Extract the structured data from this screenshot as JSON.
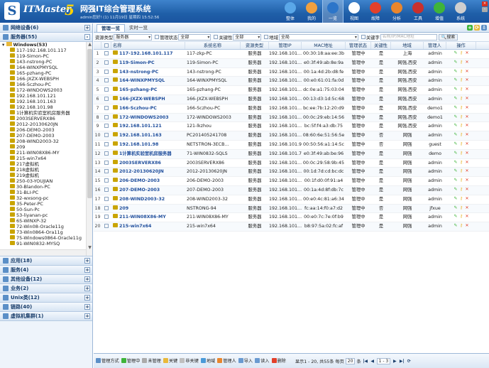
{
  "header": {
    "logo_letter": "S",
    "brand": "ITMaster",
    "brand_num": "5",
    "title": "网强IT综合管理系统",
    "user_info": "admin您好! (1) 11月19日 星期四 15:52:56"
  },
  "nav": [
    {
      "label": "整体",
      "icon": "monitor-icon",
      "color": "#5aa7e8"
    },
    {
      "label": "我的",
      "icon": "user-icon",
      "color": "#f0a040"
    },
    {
      "label": "一览",
      "icon": "list-icon",
      "color": "#2c75c9"
    },
    {
      "label": "视图",
      "icon": "view-icon",
      "color": "#ffffff"
    },
    {
      "label": "故障",
      "icon": "alert-icon",
      "color": "#e2402a"
    },
    {
      "label": "分析",
      "icon": "chart-icon",
      "color": "#e9862d"
    },
    {
      "label": "工具",
      "icon": "tool-icon",
      "color": "#c9302c"
    },
    {
      "label": "增值",
      "icon": "plus-icon",
      "color": "#3fb43a"
    },
    {
      "label": "系统",
      "icon": "gear-icon",
      "color": "#cfcfcf"
    }
  ],
  "sidebar": {
    "sections_top": [
      {
        "label": "网络设备(6)",
        "toggle": "+"
      },
      {
        "label": "服务器(55)",
        "toggle": "-"
      }
    ],
    "group": "Windows(53)",
    "tree_items": [
      "117-192.168.101.117",
      "119-Simon-PC",
      "143-nstrong-PC",
      "164-WINXPMYSQL",
      "165-pzhang-PC",
      "166-JXZX-WEBSPH",
      "166-Sczhou-PC",
      "172-WINDOWS2003",
      "192.168.101.121",
      "192.168.101.163",
      "192.168.101.98",
      "1计算机实验室机房服务器",
      "2003SERVERX86",
      "2012-20130620JN",
      "206-DEMO-2003",
      "207-DEMO-2003",
      "208-WIND2003-32",
      "209",
      "211-WIN08X86-MY",
      "215-win7x64",
      "217虚拟机",
      "218虚拟机",
      "219虚拟机",
      "250-03-YOUJIAN",
      "30-Blandon-PC",
      "31-BLI-PC",
      "32-wxsong-pc",
      "35-Peter-PC",
      "50-Sun-Pc",
      "53-liyanan-pc",
      "65-WINXP-32",
      "72-Win08-Oracle11g",
      "73-Win0864-Ora11g",
      "75-Windows0864-Oracle11g",
      "91-WIN0832-MYSQ"
    ],
    "sections_bottom": [
      {
        "label": "应用(18)",
        "toggle": "+"
      },
      {
        "label": "服务(4)",
        "toggle": "+"
      },
      {
        "label": "其他设备(12)",
        "toggle": "+"
      },
      {
        "label": "业务(2)",
        "toggle": "+"
      },
      {
        "label": "Unix类(12)",
        "toggle": "+"
      },
      {
        "label": "链路(40)",
        "toggle": "+"
      },
      {
        "label": "虚拟机集群(1)",
        "toggle": "+"
      }
    ]
  },
  "tabs": [
    "管理一览",
    "实时一览"
  ],
  "filter": {
    "type_label": "资源类型",
    "type_value": "服务器",
    "status_label": "管理状态",
    "status_value": "全部",
    "key_label": "关键性",
    "key_value": "全部",
    "region_label": "地域",
    "region_value": "全局",
    "keyword_label": "关键字",
    "keyword_placeholder": "名称/IP/MAC地址",
    "search_label": "搜索"
  },
  "table": {
    "columns": [
      "",
      "",
      "名称",
      "系统名称",
      "资源类型",
      "管理IP",
      "MAC地址",
      "管理状态",
      "关键性",
      "地域",
      "管理人",
      "操作"
    ],
    "rows": [
      [
        "1",
        "117-192.168.101.117",
        "117-zkp-PC",
        "服务器",
        "192.168.101....",
        "00:30:18:aa:ee:3b",
        "管理中",
        "是",
        "上海",
        "admin"
      ],
      [
        "2",
        "119-Simon-PC",
        "119-Simon-PC",
        "服务器",
        "192.168.101....",
        "e0:3f:49:ab:8e:9a",
        "管理中",
        "是",
        "网强,西安",
        "admin"
      ],
      [
        "3",
        "143-nstrong-PC",
        "143-nstrong-PC",
        "服务器",
        "192.168.101....",
        "00:1a:4d:2b:d8:fe",
        "管理中",
        "是",
        "网强,西安",
        "admin"
      ],
      [
        "4",
        "164-WINXPMYSQL",
        "164-WINXPMYSQL",
        "服务器",
        "192.168.101....",
        "00:e0:61:01:fa:0d",
        "管理中",
        "是",
        "网强,西安",
        "admin"
      ],
      [
        "5",
        "165-pzhang-PC",
        "165-pzhang-PC",
        "服务器",
        "192.168.101....",
        "dc:0e:a1:75:03:04",
        "管理中",
        "是",
        "网强,西安",
        "admin"
      ],
      [
        "6",
        "166-JXZX-WEBSPH",
        "166-JXZX-WEBSPH",
        "服务器",
        "192.168.101....",
        "00:13:d3:1d:5c:68",
        "管理中",
        "是",
        "网强,西安",
        "admin"
      ],
      [
        "7",
        "166-Sczhou-PC",
        "166-Sczhou-PC",
        "服务器",
        "192.168.101....",
        "bc:ee:7b:12:20:d9",
        "管理中",
        "是",
        "网强,西安",
        "demo1"
      ],
      [
        "8",
        "172-WINDOWS2003",
        "172-WINDOWS2003",
        "服务器",
        "192.168.101....",
        "00:0c:29:eb:14:56",
        "管理中",
        "是",
        "网强,西安",
        "demo1"
      ],
      [
        "9",
        "192.168.101.121",
        "121-lkzhou",
        "服务器",
        "192.168.101....",
        "bc:5f:f4:a3:db:75",
        "管理中",
        "是",
        "网强,西安",
        "admin"
      ],
      [
        "10",
        "192.168.101.163",
        "PC201405241708",
        "服务器",
        "192.168.101....",
        "08:60:6e:51:56:5e",
        "管理中",
        "否",
        "网强",
        "admin"
      ],
      [
        "11",
        "192.168.101.98",
        "NETSTRON-3ECB...",
        "服务器",
        "192.168.101.98",
        "00:50:56:a1:14:5c",
        "管理中",
        "否",
        "网强",
        "guest"
      ],
      [
        "12",
        "1计算机实验室机房服务器",
        "71-WIN0832-SQLS",
        "服务器",
        "192.168.101.71",
        "e0:3f:49:ab:be:96",
        "管理中",
        "是",
        "网强",
        "demo"
      ],
      [
        "13",
        "2003SERVERX86",
        "2003SERVERX86",
        "服务器",
        "192.168.101....",
        "00:0c:29:58:9b:45",
        "管理中",
        "是",
        "网强",
        "admin"
      ],
      [
        "14",
        "2012-20130620JN",
        "2012-20130620JN",
        "服务器",
        "192.168.101....",
        "00:1d:7d:cd:bc:dc",
        "管理中",
        "是",
        "网强",
        "admin"
      ],
      [
        "15",
        "206-DEMO-2003",
        "206-DEMO-2003",
        "服务器",
        "192.168.101....",
        "00:1f:d0:0f:91:a4",
        "管理中",
        "是",
        "网强",
        "admin"
      ],
      [
        "16",
        "207-DEMO-2003",
        "207-DEMO-2003",
        "服务器",
        "192.168.101....",
        "00:1a:4d:8f:db:7c",
        "管理中",
        "是",
        "网强",
        "admin"
      ],
      [
        "17",
        "208-WIND2003-32",
        "208-WIND2003-32",
        "服务器",
        "192.168.101....",
        "00:e0:4c:81:a6:34",
        "管理中",
        "是",
        "网强",
        "admin"
      ],
      [
        "18",
        "209",
        "NSTRONG-94",
        "服务器",
        "192.168.101....",
        "fc:aa:14:f0:a7:d2",
        "管理中",
        "否",
        "网强",
        "jfxue"
      ],
      [
        "19",
        "211-WIN08X86-MY",
        "211-WIN08X86-MY",
        "服务器",
        "192.168.101....",
        "00:e0:7c:7e:0f:b9",
        "管理中",
        "是",
        "网强",
        "admin"
      ],
      [
        "20",
        "215-win7x64",
        "215-win7x64",
        "服务器",
        "192.168.101....",
        "b8:97:5a:02:fc:af",
        "管理中",
        "是",
        "网强",
        "admin"
      ]
    ]
  },
  "bottombar": {
    "actions": [
      {
        "label": "管理方式",
        "icon": "manage-mode-icon",
        "color": "#5b8fc7"
      },
      {
        "label": "管理中",
        "icon": "play-icon",
        "color": "#3fb43a"
      },
      {
        "label": "未管理",
        "icon": "pause-icon",
        "color": "#aaaaaa"
      },
      {
        "label": "关键",
        "icon": "key-icon",
        "color": "#e9b93b"
      },
      {
        "label": "非关键",
        "icon": "key-off-icon",
        "color": "#bfbfbf"
      },
      {
        "label": "地域",
        "icon": "region-icon",
        "color": "#4a9ad8"
      },
      {
        "label": "管理人",
        "icon": "person-icon",
        "color": "#e9862d"
      },
      {
        "label": "导入",
        "icon": "import-icon",
        "color": "#6a9ad0"
      },
      {
        "label": "读入",
        "icon": "read-icon",
        "color": "#6a9ad0"
      },
      {
        "label": "删除",
        "icon": "delete-icon",
        "color": "#e2402a"
      }
    ],
    "page_info": "显示1 - 20, 共55条",
    "per_page_label": "每页",
    "per_page": "20",
    "per_page_unit": "条",
    "page_range": "1 - 3"
  },
  "colors": {
    "accent": "#1f5fa8",
    "link": "#1f4e9c",
    "danger": "#e2402a",
    "ok": "#3fb43a"
  }
}
